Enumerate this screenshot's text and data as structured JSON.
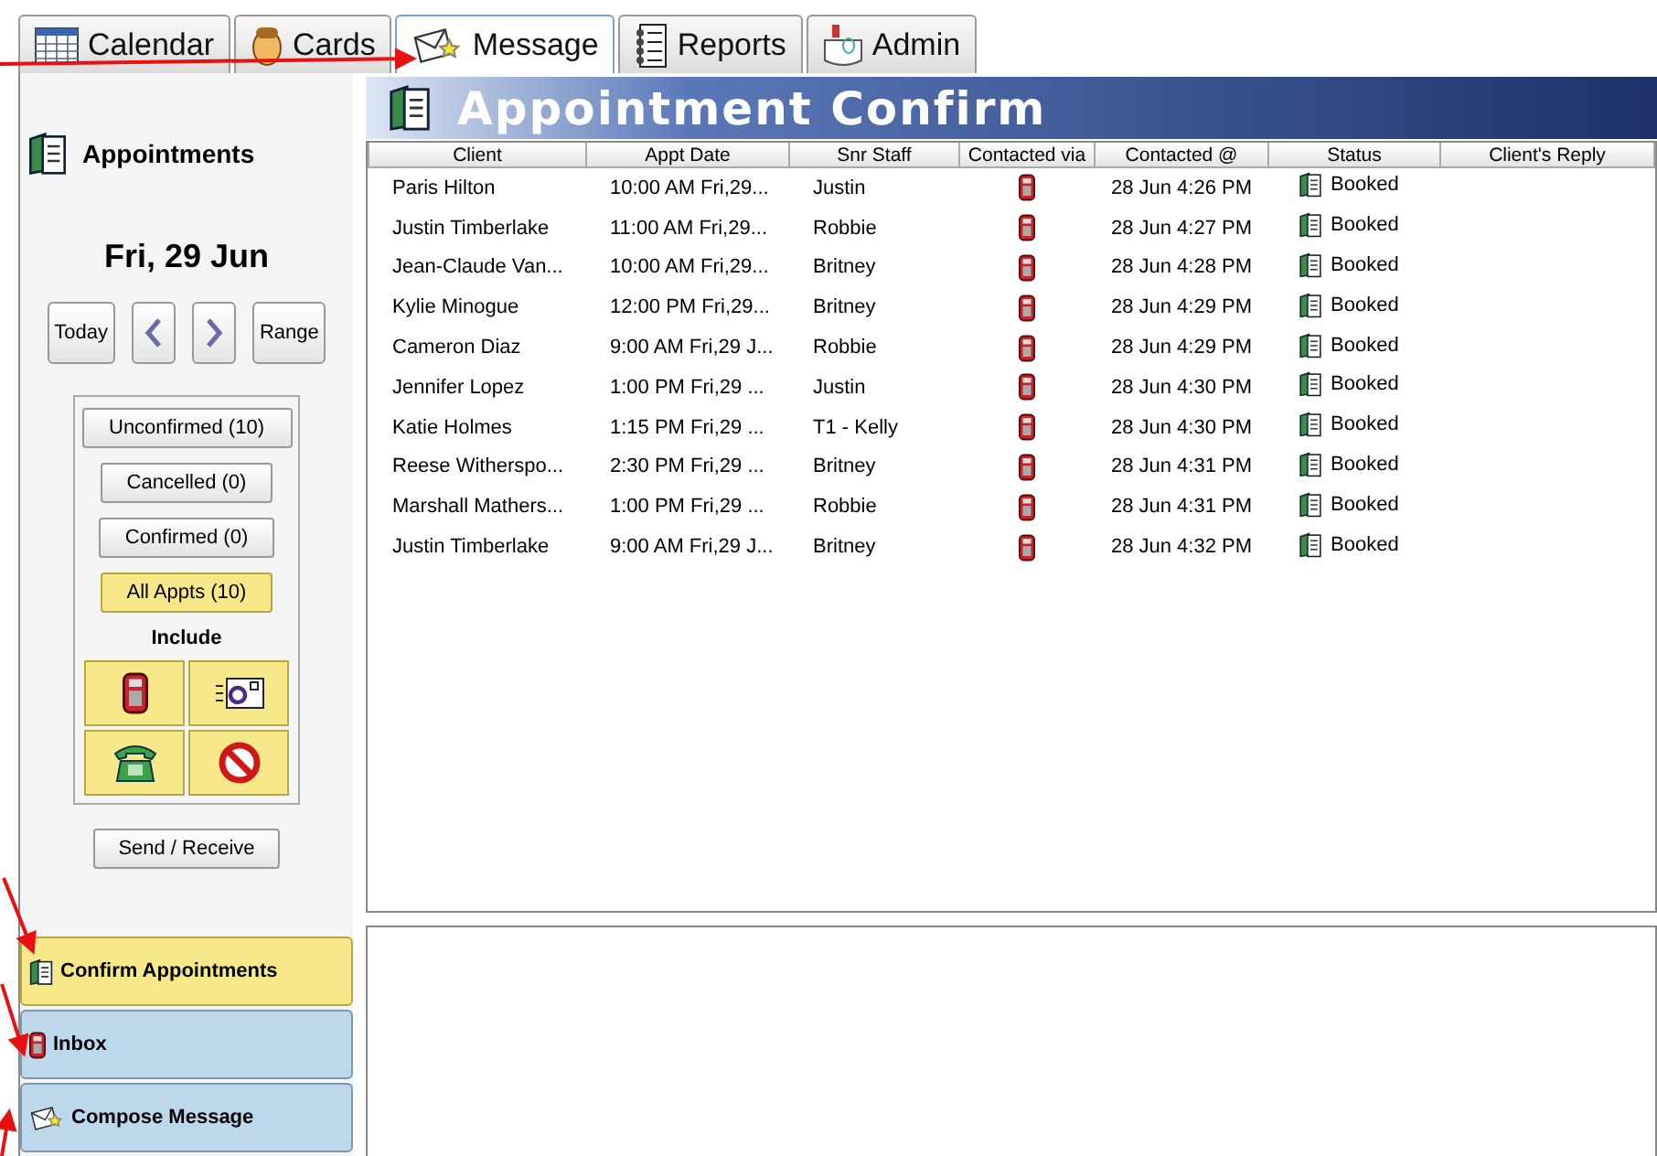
{
  "tabs": [
    {
      "label": "Calendar",
      "selected": false
    },
    {
      "label": "Cards",
      "selected": false
    },
    {
      "label": "Message",
      "selected": true
    },
    {
      "label": "Reports",
      "selected": false
    },
    {
      "label": "Admin",
      "selected": false
    }
  ],
  "sidebar": {
    "title": "Appointments",
    "date": "Fri, 29 Jun",
    "nav_buttons": [
      {
        "kind": "text",
        "label": "Today"
      },
      {
        "kind": "prev"
      },
      {
        "kind": "next"
      },
      {
        "kind": "text",
        "label": "Range"
      }
    ],
    "filters": [
      {
        "label": "Unconfirmed (10)",
        "selected": false
      },
      {
        "label": "Cancelled (0)",
        "selected": false
      },
      {
        "label": "Confirmed (0)",
        "selected": false
      },
      {
        "label": "All Appts (10)",
        "selected": true
      }
    ],
    "include_label": "Include",
    "include_options": [
      {
        "kind": "sms",
        "on": true
      },
      {
        "kind": "email",
        "on": true
      },
      {
        "kind": "phone",
        "on": true
      },
      {
        "kind": "none",
        "on": true
      }
    ],
    "send_receive": "Send / Receive",
    "sections": [
      {
        "label": "Confirm Appointments",
        "selected": true
      },
      {
        "label": "Inbox",
        "selected": false
      },
      {
        "label": "Compose Message",
        "selected": false
      }
    ]
  },
  "header": {
    "title": "Appointment Confirm"
  },
  "table": {
    "columns": [
      "Client",
      "Appt Date",
      "Snr Staff",
      "Contacted via",
      "Contacted @",
      "Status",
      "Client's Reply"
    ],
    "rows": [
      {
        "client": "Paris Hilton",
        "appt_date": "10:00 AM Fri,29...",
        "snr_staff": "Justin",
        "contacted_via": {
          "kind": "sms"
        },
        "contacted_at": "28 Jun 4:26 PM",
        "status": "Booked"
      },
      {
        "client": "Justin Timberlake",
        "appt_date": "11:00 AM Fri,29...",
        "snr_staff": "Robbie",
        "contacted_via": {
          "kind": "sms"
        },
        "contacted_at": "28 Jun 4:27 PM",
        "status": "Booked"
      },
      {
        "client": "Jean-Claude Van...",
        "appt_date": "10:00 AM Fri,29...",
        "snr_staff": "Britney",
        "contacted_via": {
          "kind": "sms"
        },
        "contacted_at": "28 Jun 4:28 PM",
        "status": "Booked"
      },
      {
        "client": "Kylie Minogue",
        "appt_date": "12:00 PM Fri,29...",
        "snr_staff": "Britney",
        "contacted_via": {
          "kind": "sms"
        },
        "contacted_at": "28 Jun 4:29 PM",
        "status": "Booked"
      },
      {
        "client": "Cameron Diaz",
        "appt_date": "9:00 AM Fri,29 J...",
        "snr_staff": "Robbie",
        "contacted_via": {
          "kind": "sms"
        },
        "contacted_at": "28 Jun 4:29 PM",
        "status": "Booked"
      },
      {
        "client": "Jennifer Lopez",
        "appt_date": "1:00 PM Fri,29 ...",
        "snr_staff": "Justin",
        "contacted_via": {
          "kind": "sms"
        },
        "contacted_at": "28 Jun 4:30 PM",
        "status": "Booked"
      },
      {
        "client": "Katie Holmes",
        "appt_date": "1:15 PM Fri,29 ...",
        "snr_staff": "T1 - Kelly",
        "contacted_via": {
          "kind": "sms"
        },
        "contacted_at": "28 Jun 4:30 PM",
        "status": "Booked"
      },
      {
        "client": "Reese Witherspo...",
        "appt_date": "2:30 PM Fri,29 ...",
        "snr_staff": "Britney",
        "contacted_via": {
          "kind": "sms"
        },
        "contacted_at": "28 Jun 4:31 PM",
        "status": "Booked"
      },
      {
        "client": "Marshall Mathers...",
        "appt_date": "1:00 PM Fri,29 ...",
        "snr_staff": "Robbie",
        "contacted_via": {
          "kind": "sms"
        },
        "contacted_at": "28 Jun 4:31 PM",
        "status": "Booked"
      },
      {
        "client": "Justin Timberlake",
        "appt_date": "9:00 AM Fri,29 J...",
        "snr_staff": "Britney",
        "contacted_via": {
          "kind": "sms"
        },
        "contacted_at": "28 Jun 4:32 PM",
        "status": "Booked"
      }
    ]
  }
}
